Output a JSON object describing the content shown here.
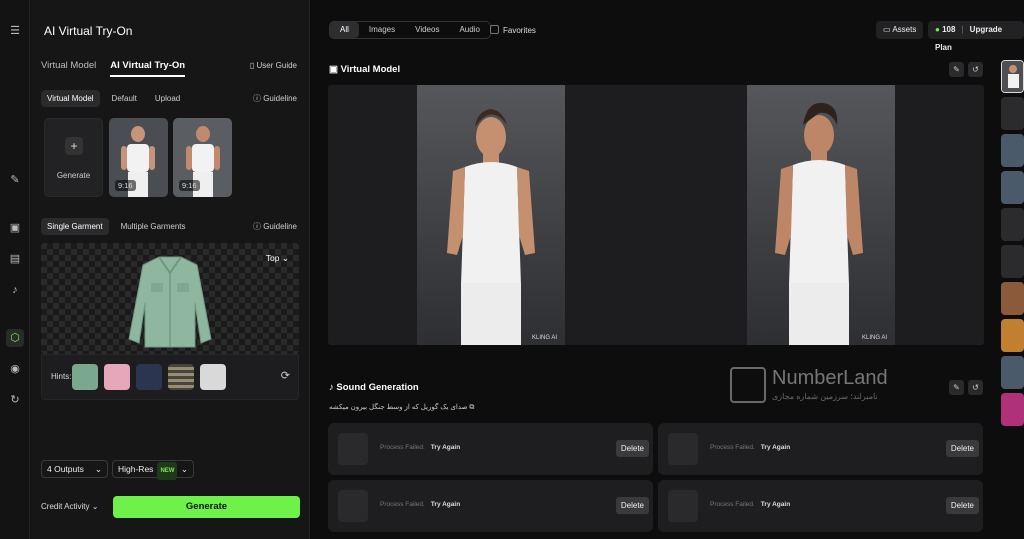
{
  "app": {
    "title": "AI Virtual Try-On"
  },
  "panel": {
    "tabs": [
      "Virtual Model",
      "AI Virtual Try-On"
    ],
    "user_guide": "User Guide",
    "model_tabs": [
      "Virtual Model",
      "Default",
      "Upload"
    ],
    "guideline": "Guideline",
    "generate_card_label": "Generate",
    "model_thumbs": [
      {
        "ratio": "9:16"
      },
      {
        "ratio": "9:16"
      }
    ],
    "garment_tabs": [
      "Single Garment",
      "Multiple Garments"
    ],
    "garment_type": "Top",
    "hints_label": "Hints:",
    "outputs": "4 Outputs",
    "resolution": "High-Res",
    "new_badge": "NEW",
    "credit_activity": "Credit Activity",
    "generate_button": "Generate"
  },
  "topbar": {
    "filters": [
      "All",
      "Images",
      "Videos",
      "Audio"
    ],
    "favorites": "Favorites",
    "assets": "Assets",
    "credits": "108",
    "upgrade": "Upgrade Plan"
  },
  "main": {
    "virtual_model_title": "Virtual Model",
    "image_watermark": "KLING AI",
    "sound_title": "Sound Generation",
    "sound_prompt": "صدای یک گوریل که از وسط جنگل بیرون میکشه",
    "cards": [
      {
        "status": "Process Failed.",
        "retry": "Try Again",
        "delete": "Delete"
      },
      {
        "status": "Process Failed.",
        "retry": "Try Again",
        "delete": "Delete"
      },
      {
        "status": "Process Failed.",
        "retry": "Try Again",
        "delete": "Delete"
      },
      {
        "status": "Process Failed.",
        "retry": "Try Again",
        "delete": "Delete"
      }
    ]
  },
  "watermark": {
    "brand": "NumberLand",
    "tagline": "نامبرلند؛ سرزمین شماره مجازی"
  },
  "colors": {
    "accent": "#6ef24a",
    "bg": "#0d0d0e",
    "panel": "#161617"
  }
}
